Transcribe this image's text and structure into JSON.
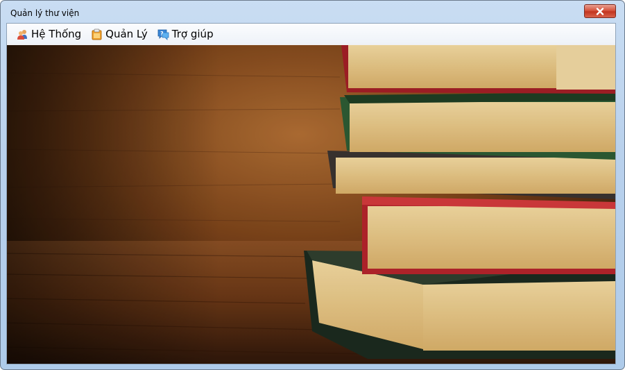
{
  "window": {
    "title": "Quản lý thư viện"
  },
  "menu": [
    {
      "label": "Hệ Thống",
      "icon": "users-icon"
    },
    {
      "label": "Quản Lý",
      "icon": "clipboard-icon"
    },
    {
      "label": "Trợ giúp",
      "icon": "help-chat-icon"
    }
  ],
  "background": {
    "subject": "stacked books on wooden table",
    "icon": "books-photo"
  },
  "colors": {
    "close_button": "#c9402b",
    "title_bar": "#b9d1ec"
  }
}
